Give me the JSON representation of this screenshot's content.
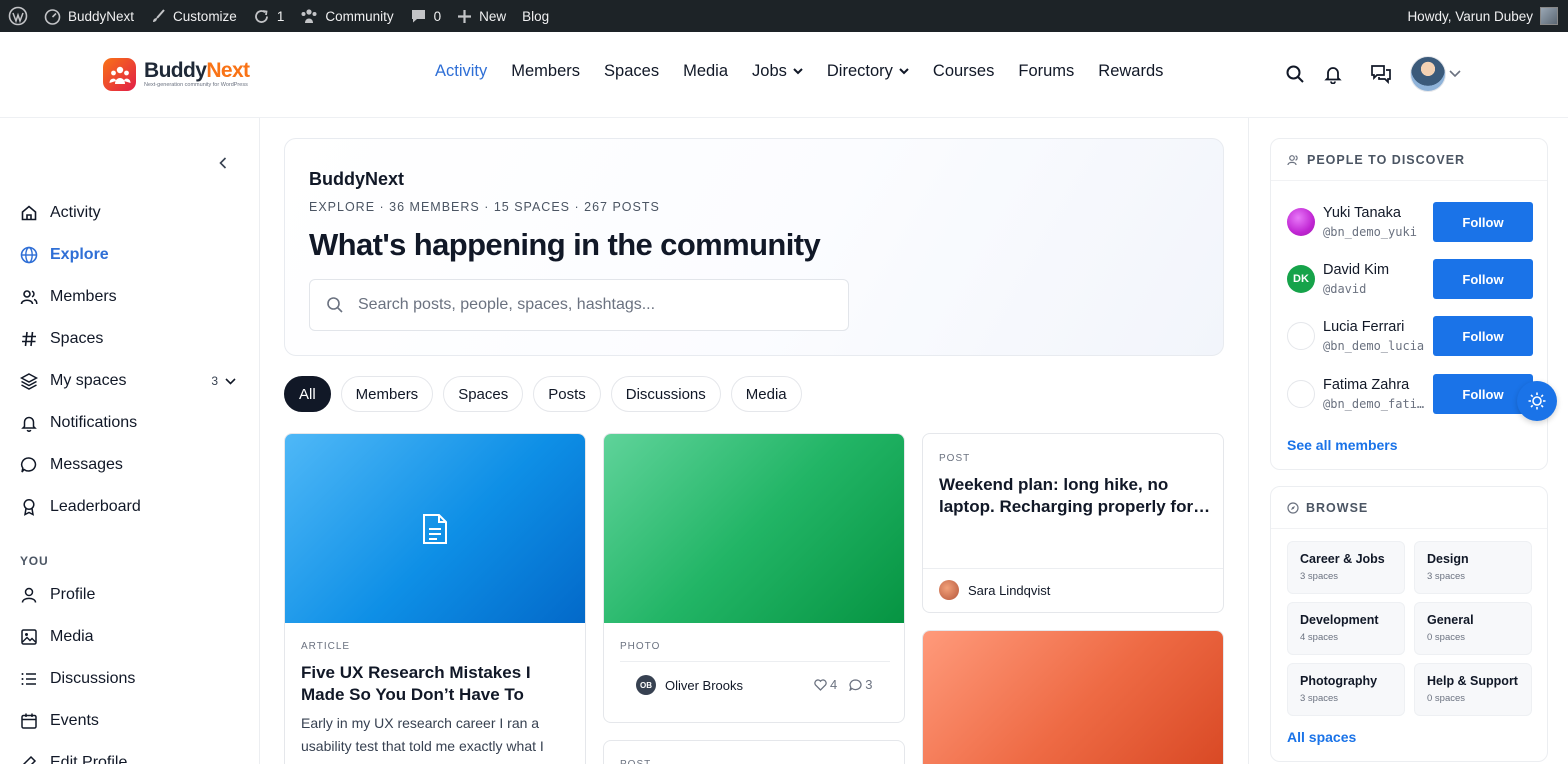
{
  "adminbar": {
    "site_name": "BuddyNext",
    "customize": "Customize",
    "updates_count": "1",
    "community": "Community",
    "comments_count": "0",
    "new": "New",
    "blog": "Blog",
    "howdy": "Howdy, Varun Dubey"
  },
  "logo": {
    "name_part1": "Buddy",
    "name_part2": "Next",
    "tagline": "Next-generation community for WordPress"
  },
  "nav": {
    "items": [
      {
        "label": "Activity",
        "active": true
      },
      {
        "label": "Members"
      },
      {
        "label": "Spaces"
      },
      {
        "label": "Media"
      },
      {
        "label": "Jobs",
        "dropdown": true
      },
      {
        "label": "Directory",
        "dropdown": true
      },
      {
        "label": "Courses"
      },
      {
        "label": "Forums"
      },
      {
        "label": "Rewards"
      }
    ]
  },
  "sidebar": {
    "items": [
      {
        "label": "Activity",
        "icon": "home-icon"
      },
      {
        "label": "Explore",
        "icon": "globe-icon",
        "active": true
      },
      {
        "label": "Members",
        "icon": "users-icon"
      },
      {
        "label": "Spaces",
        "icon": "hash-icon"
      },
      {
        "label": "My spaces",
        "icon": "layers-icon",
        "badge": "3"
      },
      {
        "label": "Notifications",
        "icon": "bell-icon"
      },
      {
        "label": "Messages",
        "icon": "chat-bubble-icon"
      },
      {
        "label": "Leaderboard",
        "icon": "award-icon"
      }
    ],
    "you_heading": "YOU",
    "you_items": [
      {
        "label": "Profile",
        "icon": "user-icon"
      },
      {
        "label": "Media",
        "icon": "image-icon"
      },
      {
        "label": "Discussions",
        "icon": "list-icon"
      },
      {
        "label": "Events",
        "icon": "calendar-icon"
      },
      {
        "label": "Edit Profile",
        "icon": "edit-icon"
      }
    ]
  },
  "hero": {
    "site": "BuddyNext",
    "meta": "EXPLORE · 36 MEMBERS · 15 SPACES · 267 POSTS",
    "title": "What's happening in the community",
    "search_placeholder": "Search posts, people, spaces, hashtags..."
  },
  "filters": [
    "All",
    "Members",
    "Spaces",
    "Posts",
    "Discussions",
    "Media"
  ],
  "cards": {
    "article": {
      "type": "ARTICLE",
      "title": "Five UX Research Mistakes I Made So You Don’t Have To",
      "excerpt": "Early in my UX research career I ran a usability test that told me exactly what I"
    },
    "photo": {
      "type": "PHOTO",
      "author": "Oliver Brooks",
      "author_initials": "OB",
      "likes": "4",
      "comments": "3"
    },
    "post": {
      "type": "POST",
      "title": "Weekend plan: long hike, no laptop. Recharging properly for…",
      "author": "Sara Lindqvist"
    },
    "post2": {
      "type": "POST"
    }
  },
  "people": {
    "heading": "PEOPLE TO DISCOVER",
    "follow_label": "Follow",
    "see_all": "See all members",
    "list": [
      {
        "name": "Yuki Tanaka",
        "handle": "@bn_demo_yuki",
        "color": "#c026d3"
      },
      {
        "name": "David Kim",
        "handle": "@david",
        "initials": "DK",
        "color": "#16a34a"
      },
      {
        "name": "Lucia Ferrari",
        "handle": "@bn_demo_lucia",
        "color": "#ffffff"
      },
      {
        "name": "Fatima Zahra",
        "handle": "@bn_demo_fatima",
        "color": "#ffffff"
      }
    ]
  },
  "browse": {
    "heading": "BROWSE",
    "all_spaces": "All spaces",
    "tiles": [
      {
        "name": "Career & Jobs",
        "count": "3 spaces"
      },
      {
        "name": "Design",
        "count": "3 spaces"
      },
      {
        "name": "Development",
        "count": "4 spaces"
      },
      {
        "name": "General",
        "count": "0 spaces"
      },
      {
        "name": "Photography",
        "count": "3 spaces"
      },
      {
        "name": "Help & Support",
        "count": "0 spaces"
      }
    ]
  },
  "colors": {
    "accent": "#1a73e8",
    "active_nav": "#2f6fd6",
    "admin_bar": "#1d2327"
  }
}
